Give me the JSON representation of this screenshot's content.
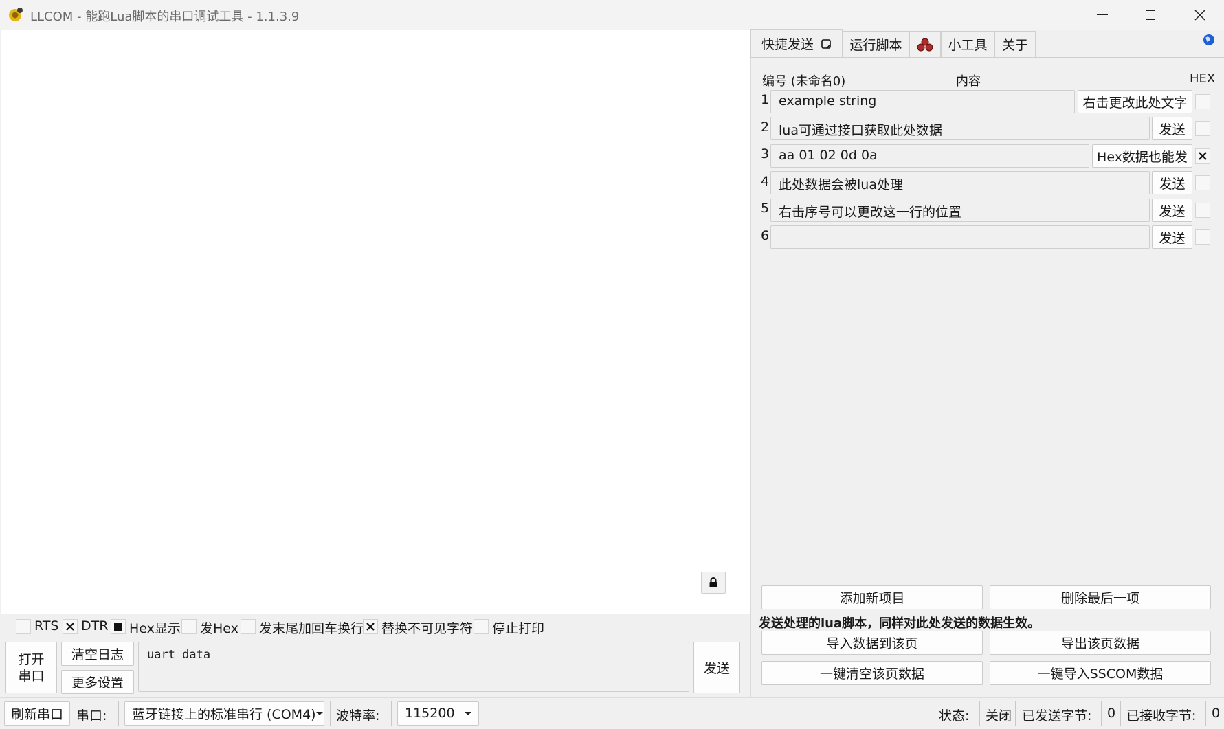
{
  "window": {
    "title": "LLCOM - 能跑Lua脚本的串口调试工具 - 1.1.3.9"
  },
  "options": {
    "rts_label": "RTS",
    "rts_checked": false,
    "dtr_label": "DTR",
    "dtr_checked": true,
    "hex_show_label": "Hex显示",
    "hex_show_checked": "indeterminate",
    "send_hex_label": "发Hex",
    "send_hex_checked": false,
    "append_crlf_label": "发末尾加回车换行",
    "append_crlf_checked": false,
    "replace_invisible_label": "替换不可见字符",
    "replace_invisible_checked": true,
    "stop_print_label": "停止打印",
    "stop_print_checked": false
  },
  "controls": {
    "open_port_line1": "打开",
    "open_port_line2": "串口",
    "clear_log": "清空日志",
    "more_settings": "更多设置",
    "send_input_value": "uart data",
    "send_button": "发送"
  },
  "tabs": [
    {
      "label": "快捷发送",
      "active": true,
      "icon": "popout-icon"
    },
    {
      "label": "运行脚本",
      "active": false
    },
    {
      "label": "",
      "active": false,
      "icon": "tool-cluster-icon"
    },
    {
      "label": "小工具",
      "active": false
    },
    {
      "label": "关于",
      "active": false
    }
  ],
  "quick_send": {
    "header_id": "编号 (未命名0)",
    "header_content": "内容",
    "header_hex": "HEX",
    "rows": [
      {
        "num": "1",
        "value": "example string",
        "button": "右击更改此处文字",
        "hex": false
      },
      {
        "num": "2",
        "value": "lua可通过接口获取此处数据",
        "button": "发送",
        "hex": false
      },
      {
        "num": "3",
        "value": "aa 01 02 0d 0a",
        "button": "Hex数据也能发",
        "hex": true
      },
      {
        "num": "4",
        "value": "此处数据会被lua处理",
        "button": "发送",
        "hex": false
      },
      {
        "num": "5",
        "value": "右击序号可以更改这一行的位置",
        "button": "发送",
        "hex": false
      },
      {
        "num": "6",
        "value": "",
        "button": "发送",
        "hex": false
      }
    ],
    "add_item": "添加新项目",
    "delete_last": "删除最后一项",
    "note": "发送处理的lua脚本，同样对此处发送的数据生效。",
    "import_data": "导入数据到该页",
    "export_data": "导出该页数据",
    "clear_page": "一键清空该页数据",
    "import_sscom": "一键导入SSCOM数据"
  },
  "statusbar": {
    "refresh_port": "刷新串口",
    "port_label": "串口:",
    "port_value": "蓝牙链接上的标准串行 (COM4)",
    "baud_label": "波特率:",
    "baud_value": "115200",
    "state_label": "状态:",
    "state_value": "关闭",
    "sent_label": "已发送字节:",
    "sent_value": "0",
    "recv_label": "已接收字节:",
    "recv_value": "0"
  },
  "colors": {
    "accent_blue": "#1f5fd6",
    "tool_icon_red": "#b02a2a",
    "app_icon_yellow": "#e7b417"
  }
}
